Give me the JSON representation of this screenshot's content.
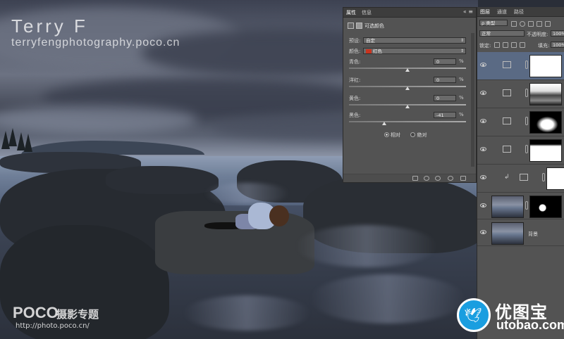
{
  "photo": {
    "watermark_title": "Terry  F",
    "watermark_url": "terryfengphotography.poco.cn",
    "logo_brand": "POCO",
    "logo_sub": "摄影专题",
    "logo_url": "http://photo.poco.cn/"
  },
  "properties_panel": {
    "tabs": [
      "属性",
      "信息"
    ],
    "menu_glyph": "«  ≡",
    "title": "可选颜色",
    "preset": {
      "label": "预设:",
      "value": "自定"
    },
    "colors": {
      "label": "颜色:",
      "value": "红色",
      "swatch_color": "#c8341f"
    },
    "sliders": [
      {
        "label": "青色:",
        "value": "0",
        "unit": "%",
        "position": 0.5
      },
      {
        "label": "洋红:",
        "value": "0",
        "unit": "%",
        "position": 0.5
      },
      {
        "label": "黄色:",
        "value": "0",
        "unit": "%",
        "position": 0.5
      },
      {
        "label": "黑色:",
        "value": "-41",
        "unit": "%",
        "position": 0.3
      }
    ],
    "method": {
      "relative": "相对",
      "absolute": "绝对",
      "selected": "relative"
    }
  },
  "layers_panel": {
    "tabs": [
      "图层",
      "通道",
      "路径"
    ],
    "filter_type": "ρ 类型",
    "blend_mode": "正常",
    "opacity_label": "不透明度:",
    "opacity_value": "100%",
    "lock_label": "锁定:",
    "fill_label": "填充:",
    "fill_value": "100%",
    "layers": [
      {
        "kind": "selective-color",
        "selected": true,
        "mask": "white"
      },
      {
        "kind": "levels",
        "selected": false,
        "mask": "rocks"
      },
      {
        "kind": "brightness",
        "selected": false,
        "mask": "black-white"
      },
      {
        "kind": "curves",
        "selected": false,
        "mask": "mostly-white"
      },
      {
        "kind": "curves-clipped",
        "selected": false,
        "mask": "white"
      },
      {
        "kind": "photo-masked",
        "selected": false,
        "mask": "black-spot"
      },
      {
        "kind": "photo",
        "selected": false,
        "name": "背景"
      }
    ]
  },
  "site_logo": {
    "cn": "优图宝",
    "en": "utobao.com"
  }
}
